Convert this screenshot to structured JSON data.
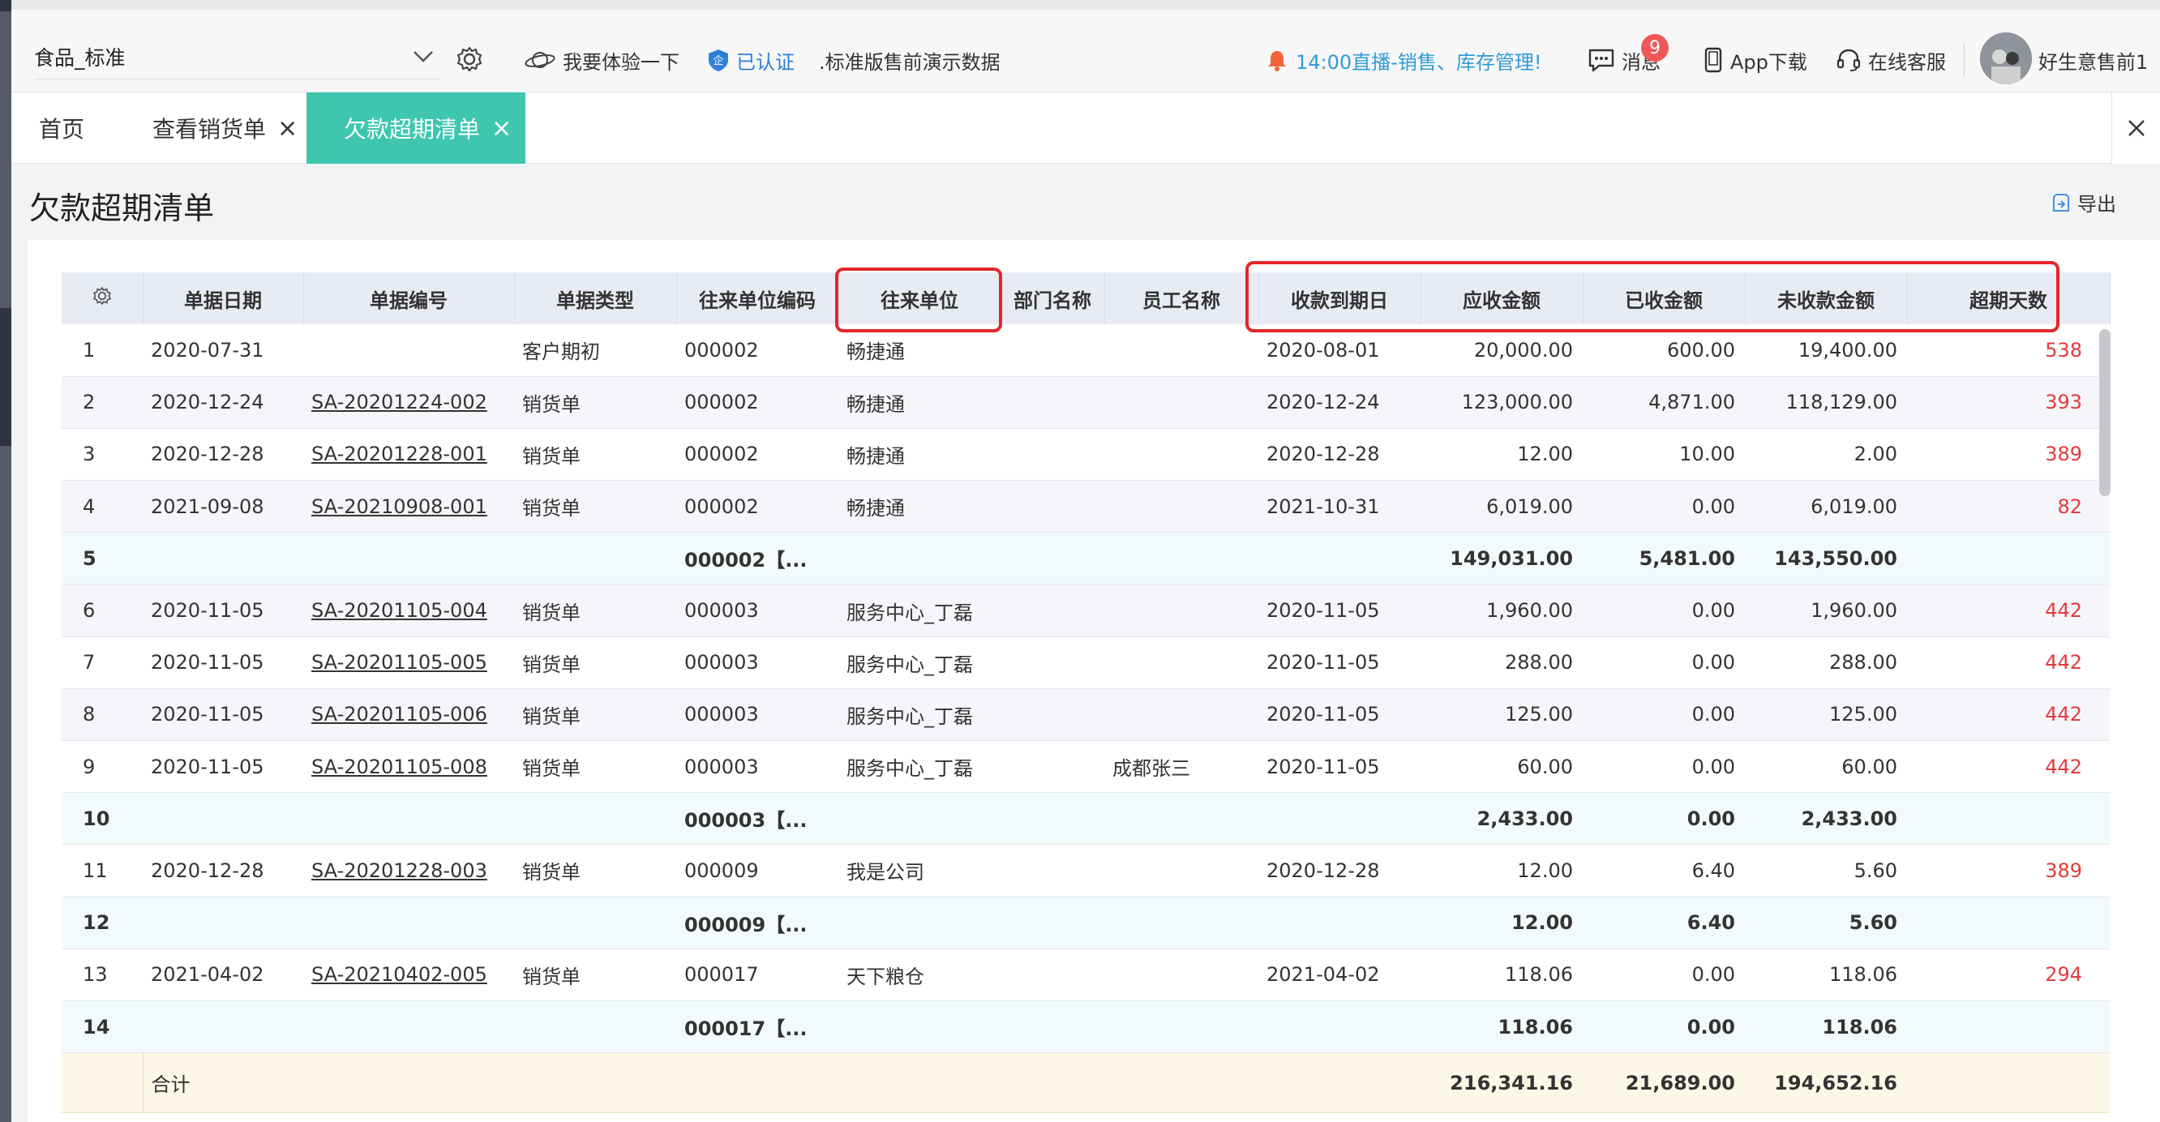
{
  "header": {
    "company": "食品_标准",
    "try_label": "我要体验一下",
    "certified_label": "已认证",
    "demo_label": ".标准版售前演示数据",
    "live_label": "14:00直播-销售、库存管理!",
    "messages_label": "消息",
    "messages_badge": "9",
    "app_label": "App下载",
    "service_label": "在线客服",
    "user_name": "好生意售前1"
  },
  "tabs": [
    {
      "label": "首页"
    },
    {
      "label": "查看销货单",
      "close": "×"
    },
    {
      "label": "欠款超期清单",
      "close": "×"
    }
  ],
  "page": {
    "title": "欠款超期清单",
    "export_label": "导出"
  },
  "table": {
    "columns": [
      "单据日期",
      "单据编号",
      "单据类型",
      "往来单位编码",
      "往来单位",
      "部门名称",
      "员工名称",
      "收款到期日",
      "应收金额",
      "已收金额",
      "未收款金额",
      "超期天数"
    ],
    "rows": [
      {
        "idx": "1",
        "date": "2020-07-31",
        "code": "",
        "type": "客户期初",
        "unit_code": "000002",
        "unit": "畅捷通",
        "dept": "",
        "emp": "",
        "due": "2020-08-01",
        "receivable": "20,000.00",
        "received": "600.00",
        "outstanding": "19,400.00",
        "overdue": "538",
        "subtotal": false
      },
      {
        "idx": "2",
        "date": "2020-12-24",
        "code": "SA-20201224-002",
        "type": "销货单",
        "unit_code": "000002",
        "unit": "畅捷通",
        "dept": "",
        "emp": "",
        "due": "2020-12-24",
        "receivable": "123,000.00",
        "received": "4,871.00",
        "outstanding": "118,129.00",
        "overdue": "393",
        "subtotal": false
      },
      {
        "idx": "3",
        "date": "2020-12-28",
        "code": "SA-20201228-001",
        "type": "销货单",
        "unit_code": "000002",
        "unit": "畅捷通",
        "dept": "",
        "emp": "",
        "due": "2020-12-28",
        "receivable": "12.00",
        "received": "10.00",
        "outstanding": "2.00",
        "overdue": "389",
        "subtotal": false
      },
      {
        "idx": "4",
        "date": "2021-09-08",
        "code": "SA-20210908-001",
        "type": "销货单",
        "unit_code": "000002",
        "unit": "畅捷通",
        "dept": "",
        "emp": "",
        "due": "2021-10-31",
        "receivable": "6,019.00",
        "received": "0.00",
        "outstanding": "6,019.00",
        "overdue": "82",
        "subtotal": false
      },
      {
        "idx": "5",
        "date": "",
        "code": "",
        "type": "",
        "unit_code": "000002【...",
        "unit": "",
        "dept": "",
        "emp": "",
        "due": "",
        "receivable": "149,031.00",
        "received": "5,481.00",
        "outstanding": "143,550.00",
        "overdue": "",
        "subtotal": true
      },
      {
        "idx": "6",
        "date": "2020-11-05",
        "code": "SA-20201105-004",
        "type": "销货单",
        "unit_code": "000003",
        "unit": "服务中心_丁磊",
        "dept": "",
        "emp": "",
        "due": "2020-11-05",
        "receivable": "1,960.00",
        "received": "0.00",
        "outstanding": "1,960.00",
        "overdue": "442",
        "subtotal": false
      },
      {
        "idx": "7",
        "date": "2020-11-05",
        "code": "SA-20201105-005",
        "type": "销货单",
        "unit_code": "000003",
        "unit": "服务中心_丁磊",
        "dept": "",
        "emp": "",
        "due": "2020-11-05",
        "receivable": "288.00",
        "received": "0.00",
        "outstanding": "288.00",
        "overdue": "442",
        "subtotal": false
      },
      {
        "idx": "8",
        "date": "2020-11-05",
        "code": "SA-20201105-006",
        "type": "销货单",
        "unit_code": "000003",
        "unit": "服务中心_丁磊",
        "dept": "",
        "emp": "",
        "due": "2020-11-05",
        "receivable": "125.00",
        "received": "0.00",
        "outstanding": "125.00",
        "overdue": "442",
        "subtotal": false
      },
      {
        "idx": "9",
        "date": "2020-11-05",
        "code": "SA-20201105-008",
        "type": "销货单",
        "unit_code": "000003",
        "unit": "服务中心_丁磊",
        "dept": "",
        "emp": "成都张三",
        "due": "2020-11-05",
        "receivable": "60.00",
        "received": "0.00",
        "outstanding": "60.00",
        "overdue": "442",
        "subtotal": false
      },
      {
        "idx": "10",
        "date": "",
        "code": "",
        "type": "",
        "unit_code": "000003【...",
        "unit": "",
        "dept": "",
        "emp": "",
        "due": "",
        "receivable": "2,433.00",
        "received": "0.00",
        "outstanding": "2,433.00",
        "overdue": "",
        "subtotal": true
      },
      {
        "idx": "11",
        "date": "2020-12-28",
        "code": "SA-20201228-003",
        "type": "销货单",
        "unit_code": "000009",
        "unit": "我是公司",
        "dept": "",
        "emp": "",
        "due": "2020-12-28",
        "receivable": "12.00",
        "received": "6.40",
        "outstanding": "5.60",
        "overdue": "389",
        "subtotal": false
      },
      {
        "idx": "12",
        "date": "",
        "code": "",
        "type": "",
        "unit_code": "000009【...",
        "unit": "",
        "dept": "",
        "emp": "",
        "due": "",
        "receivable": "12.00",
        "received": "6.40",
        "outstanding": "5.60",
        "overdue": "",
        "subtotal": true
      },
      {
        "idx": "13",
        "date": "2021-04-02",
        "code": "SA-20210402-005",
        "type": "销货单",
        "unit_code": "000017",
        "unit": "天下粮仓",
        "dept": "",
        "emp": "",
        "due": "2021-04-02",
        "receivable": "118.06",
        "received": "0.00",
        "outstanding": "118.06",
        "overdue": "294",
        "subtotal": false
      },
      {
        "idx": "14",
        "date": "",
        "code": "",
        "type": "",
        "unit_code": "000017【...",
        "unit": "",
        "dept": "",
        "emp": "",
        "due": "",
        "receivable": "118.06",
        "received": "0.00",
        "outstanding": "118.06",
        "overdue": "",
        "subtotal": true
      }
    ],
    "total": {
      "label": "合计",
      "receivable": "216,341.16",
      "received": "21,689.00",
      "outstanding": "194,652.16"
    }
  },
  "colors": {
    "accent_tab": "#3ec7ae",
    "overdue_red": "#e23b3b",
    "highlight_red": "#e4262a",
    "link_blue": "#2f7fd8"
  }
}
